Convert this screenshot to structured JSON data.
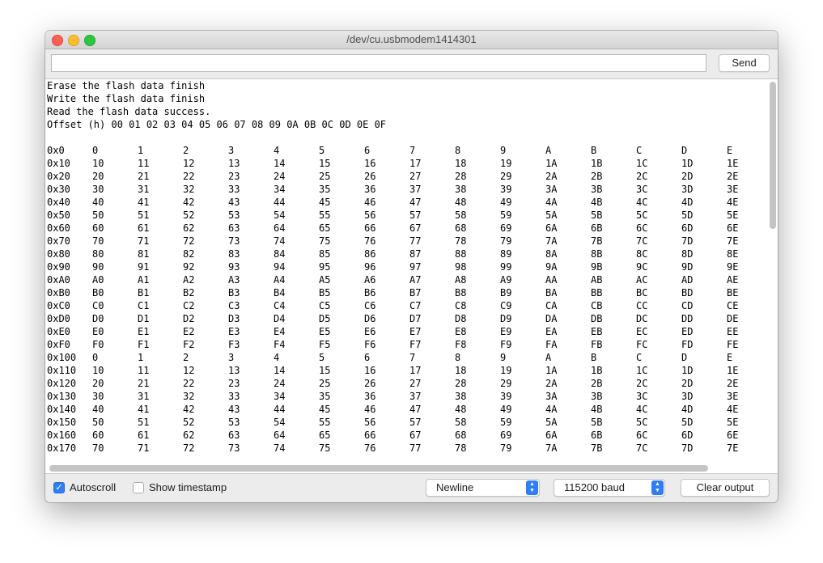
{
  "window": {
    "title": "/dev/cu.usbmodem1414301"
  },
  "send": {
    "input_value": "",
    "button_label": "Send"
  },
  "output": {
    "messages": [
      "Erase the flash data finish",
      "Write the flash data finish",
      "Read the flash data success.",
      "Offset (h) 00 01 02 03 04 05 06 07 08 09 0A 0B 0C 0D 0E 0F",
      ""
    ],
    "rows": [
      [
        "0x0",
        "0",
        "1",
        "2",
        "3",
        "4",
        "5",
        "6",
        "7",
        "8",
        "9",
        "A",
        "B",
        "C",
        "D",
        "E"
      ],
      [
        "0x10",
        "10",
        "11",
        "12",
        "13",
        "14",
        "15",
        "16",
        "17",
        "18",
        "19",
        "1A",
        "1B",
        "1C",
        "1D",
        "1E"
      ],
      [
        "0x20",
        "20",
        "21",
        "22",
        "23",
        "24",
        "25",
        "26",
        "27",
        "28",
        "29",
        "2A",
        "2B",
        "2C",
        "2D",
        "2E"
      ],
      [
        "0x30",
        "30",
        "31",
        "32",
        "33",
        "34",
        "35",
        "36",
        "37",
        "38",
        "39",
        "3A",
        "3B",
        "3C",
        "3D",
        "3E"
      ],
      [
        "0x40",
        "40",
        "41",
        "42",
        "43",
        "44",
        "45",
        "46",
        "47",
        "48",
        "49",
        "4A",
        "4B",
        "4C",
        "4D",
        "4E"
      ],
      [
        "0x50",
        "50",
        "51",
        "52",
        "53",
        "54",
        "55",
        "56",
        "57",
        "58",
        "59",
        "5A",
        "5B",
        "5C",
        "5D",
        "5E"
      ],
      [
        "0x60",
        "60",
        "61",
        "62",
        "63",
        "64",
        "65",
        "66",
        "67",
        "68",
        "69",
        "6A",
        "6B",
        "6C",
        "6D",
        "6E"
      ],
      [
        "0x70",
        "70",
        "71",
        "72",
        "73",
        "74",
        "75",
        "76",
        "77",
        "78",
        "79",
        "7A",
        "7B",
        "7C",
        "7D",
        "7E"
      ],
      [
        "0x80",
        "80",
        "81",
        "82",
        "83",
        "84",
        "85",
        "86",
        "87",
        "88",
        "89",
        "8A",
        "8B",
        "8C",
        "8D",
        "8E"
      ],
      [
        "0x90",
        "90",
        "91",
        "92",
        "93",
        "94",
        "95",
        "96",
        "97",
        "98",
        "99",
        "9A",
        "9B",
        "9C",
        "9D",
        "9E"
      ],
      [
        "0xA0",
        "A0",
        "A1",
        "A2",
        "A3",
        "A4",
        "A5",
        "A6",
        "A7",
        "A8",
        "A9",
        "AA",
        "AB",
        "AC",
        "AD",
        "AE"
      ],
      [
        "0xB0",
        "B0",
        "B1",
        "B2",
        "B3",
        "B4",
        "B5",
        "B6",
        "B7",
        "B8",
        "B9",
        "BA",
        "BB",
        "BC",
        "BD",
        "BE"
      ],
      [
        "0xC0",
        "C0",
        "C1",
        "C2",
        "C3",
        "C4",
        "C5",
        "C6",
        "C7",
        "C8",
        "C9",
        "CA",
        "CB",
        "CC",
        "CD",
        "CE"
      ],
      [
        "0xD0",
        "D0",
        "D1",
        "D2",
        "D3",
        "D4",
        "D5",
        "D6",
        "D7",
        "D8",
        "D9",
        "DA",
        "DB",
        "DC",
        "DD",
        "DE"
      ],
      [
        "0xE0",
        "E0",
        "E1",
        "E2",
        "E3",
        "E4",
        "E5",
        "E6",
        "E7",
        "E8",
        "E9",
        "EA",
        "EB",
        "EC",
        "ED",
        "EE"
      ],
      [
        "0xF0",
        "F0",
        "F1",
        "F2",
        "F3",
        "F4",
        "F5",
        "F6",
        "F7",
        "F8",
        "F9",
        "FA",
        "FB",
        "FC",
        "FD",
        "FE"
      ],
      [
        "0x100",
        "0",
        "1",
        "2",
        "3",
        "4",
        "5",
        "6",
        "7",
        "8",
        "9",
        "A",
        "B",
        "C",
        "D",
        "E"
      ],
      [
        "0x110",
        "10",
        "11",
        "12",
        "13",
        "14",
        "15",
        "16",
        "17",
        "18",
        "19",
        "1A",
        "1B",
        "1C",
        "1D",
        "1E"
      ],
      [
        "0x120",
        "20",
        "21",
        "22",
        "23",
        "24",
        "25",
        "26",
        "27",
        "28",
        "29",
        "2A",
        "2B",
        "2C",
        "2D",
        "2E"
      ],
      [
        "0x130",
        "30",
        "31",
        "32",
        "33",
        "34",
        "35",
        "36",
        "37",
        "38",
        "39",
        "3A",
        "3B",
        "3C",
        "3D",
        "3E"
      ],
      [
        "0x140",
        "40",
        "41",
        "42",
        "43",
        "44",
        "45",
        "46",
        "47",
        "48",
        "49",
        "4A",
        "4B",
        "4C",
        "4D",
        "4E"
      ],
      [
        "0x150",
        "50",
        "51",
        "52",
        "53",
        "54",
        "55",
        "56",
        "57",
        "58",
        "59",
        "5A",
        "5B",
        "5C",
        "5D",
        "5E"
      ],
      [
        "0x160",
        "60",
        "61",
        "62",
        "63",
        "64",
        "65",
        "66",
        "67",
        "68",
        "69",
        "6A",
        "6B",
        "6C",
        "6D",
        "6E"
      ],
      [
        "0x170",
        "70",
        "71",
        "72",
        "73",
        "74",
        "75",
        "76",
        "77",
        "78",
        "79",
        "7A",
        "7B",
        "7C",
        "7D",
        "7E"
      ]
    ]
  },
  "footer": {
    "autoscroll_label": "Autoscroll",
    "autoscroll_checked": true,
    "timestamp_label": "Show timestamp",
    "timestamp_checked": false,
    "line_ending_value": "Newline",
    "baud_value": "115200 baud",
    "clear_label": "Clear output"
  },
  "colors": {
    "accent": "#2f7ef6",
    "close": "#fe5f57",
    "minimize": "#febc2e",
    "maximize": "#28c840"
  }
}
